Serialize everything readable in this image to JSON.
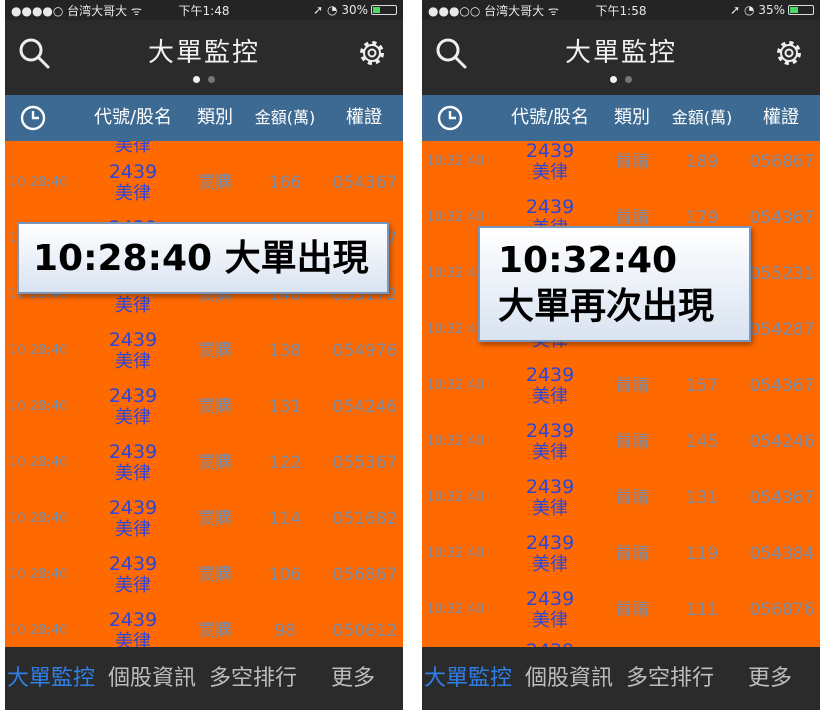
{
  "screens": [
    {
      "status": {
        "carrier": "●●●●○ 台湾大哥大 ᯤ",
        "time": "下午1:48",
        "battery": "➚ ◔ 30%",
        "battery_level": 0.3,
        "battery_color": "#4cd964"
      },
      "header": {
        "title": "大單監控",
        "left_icon": "search-icon",
        "right_icon": "gear-icon"
      },
      "page_dots": {
        "count": 2,
        "active": 1
      },
      "columns": {
        "time_icon": "clock-icon",
        "code": "代號/股名",
        "type": "類別",
        "amount": "金額(萬)",
        "warrant": "權證"
      },
      "rows": [
        {
          "time": "",
          "code": "2439",
          "name": "美律",
          "type": "",
          "amount": "",
          "warrant": ""
        },
        {
          "time": "10:28:40",
          "code": "2439",
          "name": "美律",
          "type": "買購",
          "amount": "166",
          "warrant": "054367"
        },
        {
          "time": "10:28:40",
          "code": "2439",
          "name": "美律",
          "type": "買購",
          "amount": "157",
          "warrant": "054367"
        },
        {
          "time": "10:28:40",
          "code": "2439",
          "name": "美律",
          "type": "買購",
          "amount": "146",
          "warrant": "053172"
        },
        {
          "time": "10:28:40",
          "code": "2439",
          "name": "美律",
          "type": "買購",
          "amount": "138",
          "warrant": "054976"
        },
        {
          "time": "10:28:40",
          "code": "2439",
          "name": "美律",
          "type": "買購",
          "amount": "131",
          "warrant": "054246"
        },
        {
          "time": "10:28:40",
          "code": "2439",
          "name": "美律",
          "type": "買購",
          "amount": "122",
          "warrant": "055367"
        },
        {
          "time": "10:28:40",
          "code": "2439",
          "name": "美律",
          "type": "買購",
          "amount": "114",
          "warrant": "051682"
        },
        {
          "time": "10:28:40",
          "code": "2439",
          "name": "美律",
          "type": "買購",
          "amount": "106",
          "warrant": "056867"
        },
        {
          "time": "10:28:40",
          "code": "2439",
          "name": "美律",
          "type": "買購",
          "amount": "98",
          "warrant": "050612"
        }
      ],
      "callout": {
        "lines": [
          "10:28:40 大單出現"
        ]
      },
      "tabs": [
        {
          "label": "大單監控"
        },
        {
          "label": "個股資訊"
        },
        {
          "label": "多空排行"
        },
        {
          "label": "更多"
        }
      ],
      "active_tab": 0
    },
    {
      "status": {
        "carrier": "●●●○○ 台湾大哥大 ᯤ",
        "time": "下午1:58",
        "battery": "➚ ◔ 35%",
        "battery_level": 0.35,
        "battery_color": "#4cd964"
      },
      "header": {
        "title": "大單監控",
        "left_icon": "search-icon",
        "right_icon": "gear-icon"
      },
      "page_dots": {
        "count": 2,
        "active": 1
      },
      "columns": {
        "time_icon": "clock-icon",
        "code": "代號/股名",
        "type": "類別",
        "amount": "金額(萬)",
        "warrant": "權證"
      },
      "rows": [
        {
          "time": "10:32:40",
          "code": "2439",
          "name": "美律",
          "type": "買購",
          "amount": "189",
          "warrant": "056867"
        },
        {
          "time": "10:32:40",
          "code": "2439",
          "name": "美律",
          "type": "買購",
          "amount": "179",
          "warrant": "054367"
        },
        {
          "time": "10:32:40",
          "code": "2439",
          "name": "美律",
          "type": "買購",
          "amount": "168",
          "warrant": "055231"
        },
        {
          "time": "10:32:40",
          "code": "2439",
          "name": "美律",
          "type": "買購",
          "amount": "161",
          "warrant": "054287"
        },
        {
          "time": "10:32:40",
          "code": "2439",
          "name": "美律",
          "type": "買購",
          "amount": "157",
          "warrant": "054367"
        },
        {
          "time": "10:32:40",
          "code": "2439",
          "name": "美律",
          "type": "買購",
          "amount": "145",
          "warrant": "054246"
        },
        {
          "time": "10:32:40",
          "code": "2439",
          "name": "美律",
          "type": "買購",
          "amount": "131",
          "warrant": "054367"
        },
        {
          "time": "10:32:40",
          "code": "2439",
          "name": "美律",
          "type": "買購",
          "amount": "119",
          "warrant": "054384"
        },
        {
          "time": "10:32:40",
          "code": "2439",
          "name": "美律",
          "type": "買購",
          "amount": "111",
          "warrant": "056876"
        },
        {
          "time": "",
          "code": "2439",
          "name": "",
          "type": "",
          "amount": "",
          "warrant": ""
        }
      ],
      "callout": {
        "lines": [
          "10:32:40",
          "大單再次出現"
        ]
      },
      "tabs": [
        {
          "label": "大單監控"
        },
        {
          "label": "個股資訊"
        },
        {
          "label": "多空排行"
        },
        {
          "label": "更多"
        }
      ],
      "active_tab": 0
    }
  ],
  "colors": {
    "list_background": "#fe6a00",
    "header_bar": "#3d6a93",
    "stock_text": "#2c46d9",
    "active_tab": "#2f7fe8",
    "dark_background": "#2b2b2b"
  }
}
